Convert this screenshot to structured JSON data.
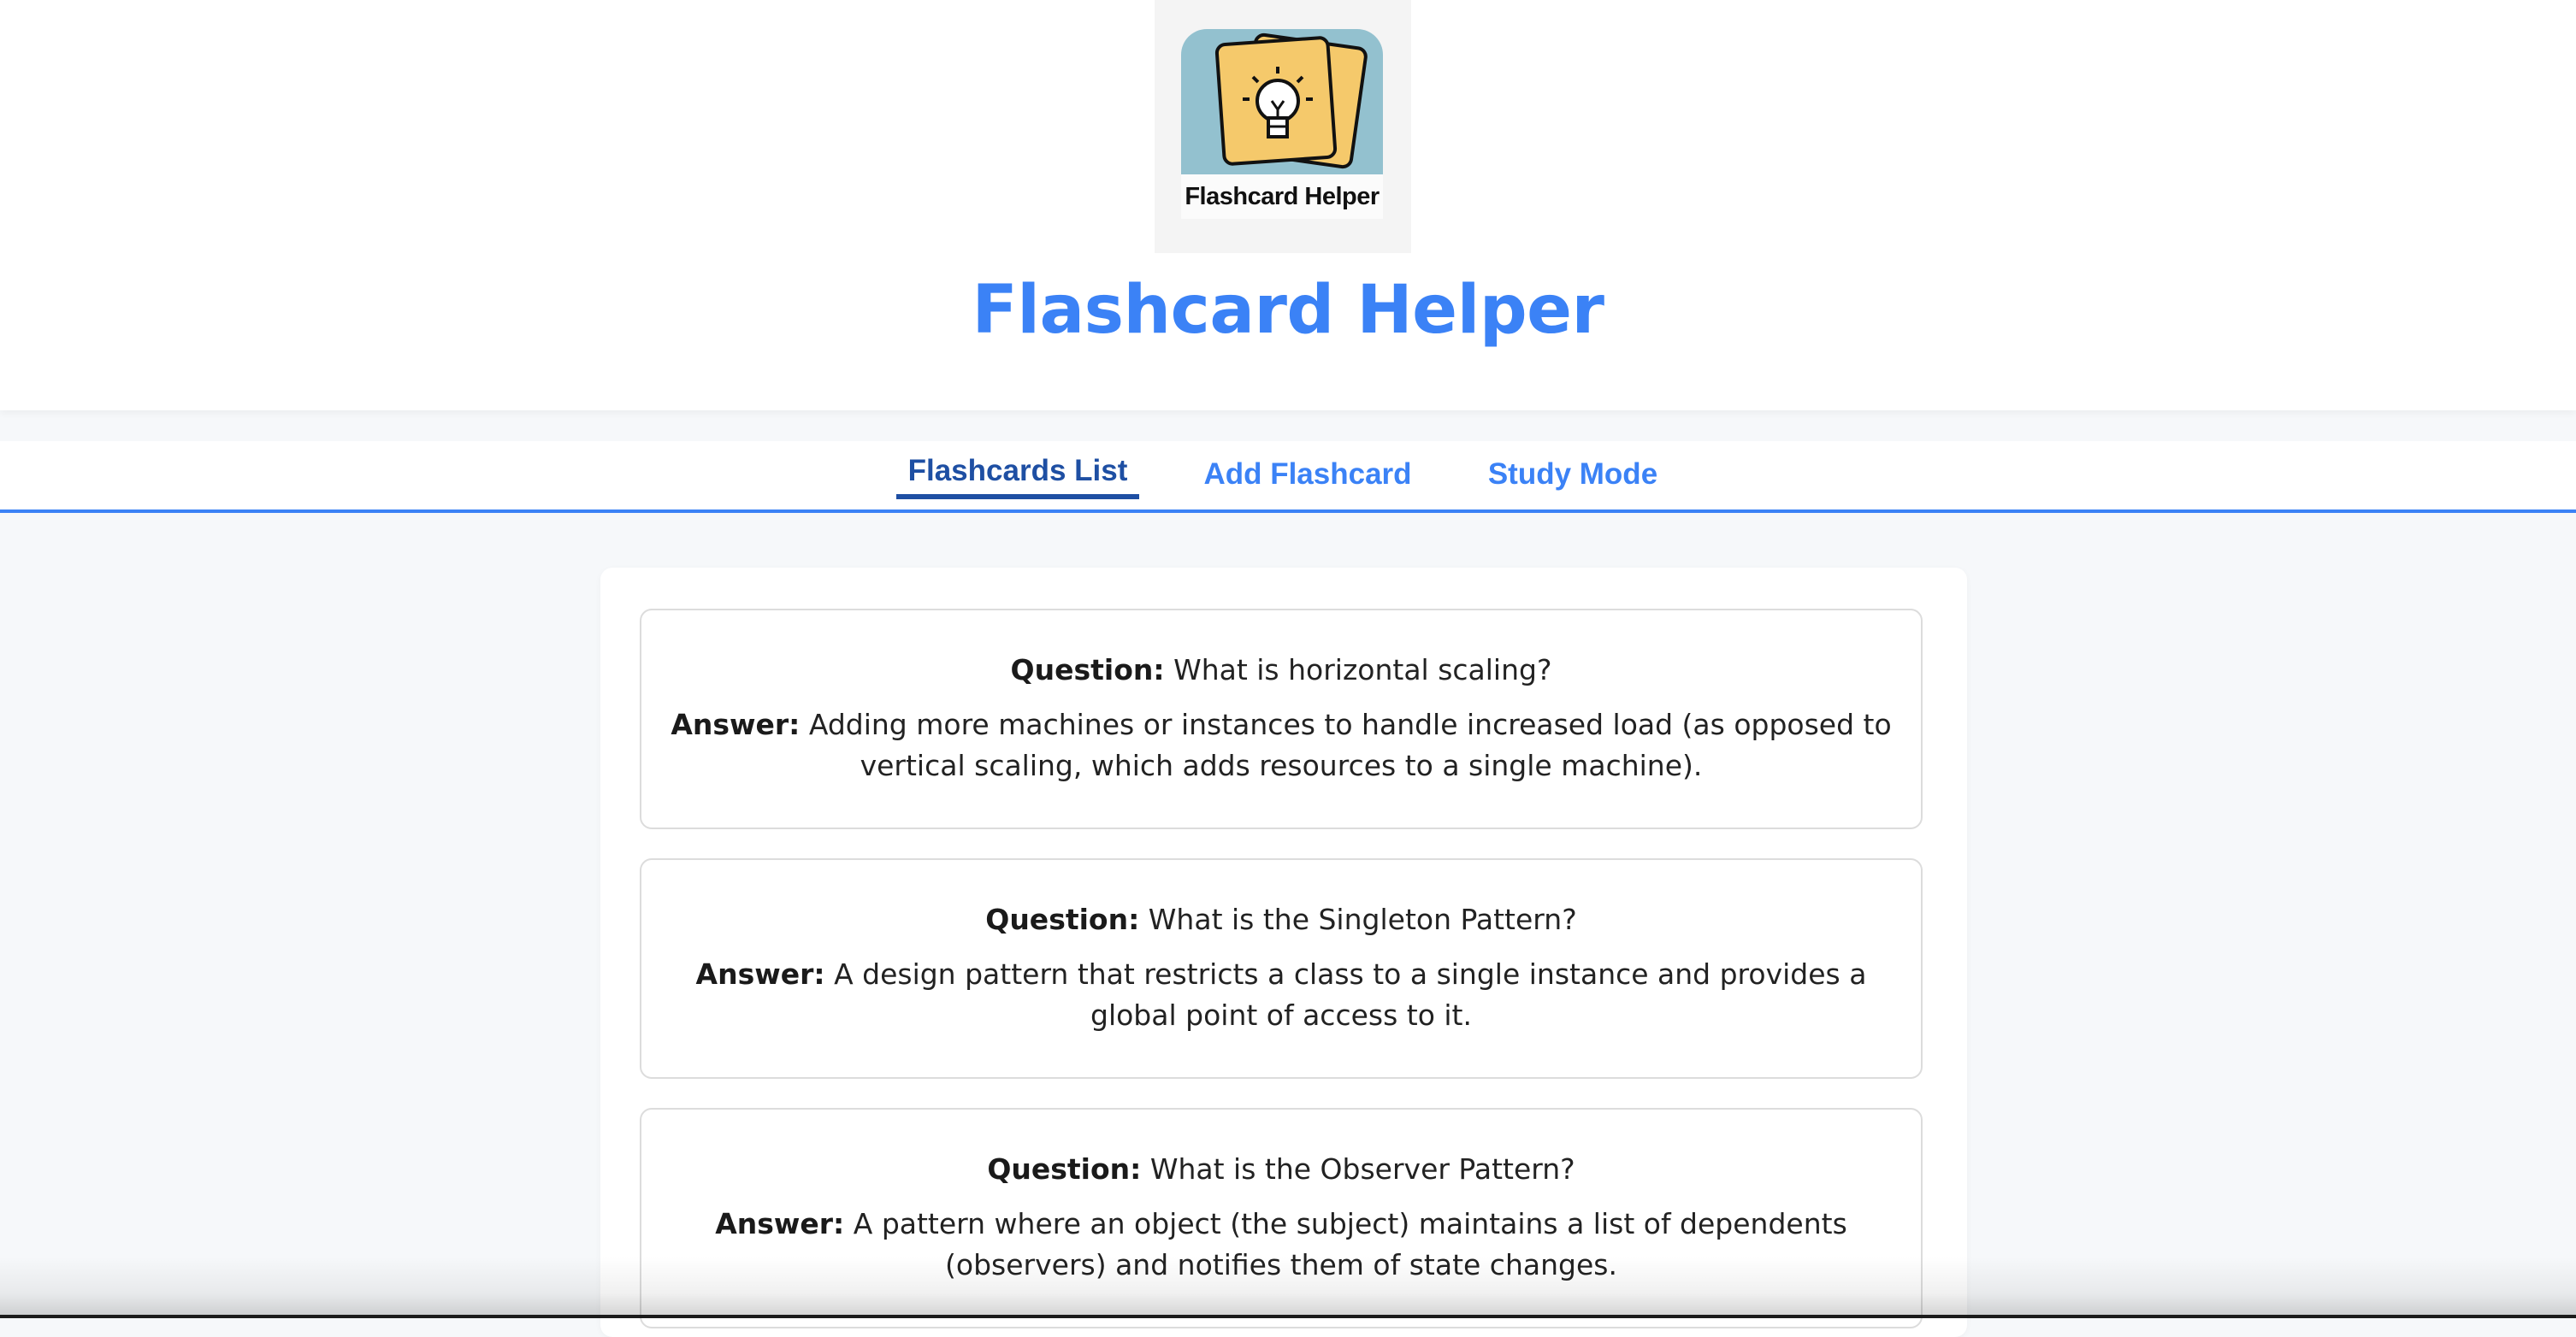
{
  "header": {
    "logo_caption": "Flashcard Helper",
    "logo_icon": "lightbulb-icon",
    "title": "Flashcard Helper"
  },
  "nav": {
    "tabs": [
      {
        "label": "Flashcards List",
        "active": true
      },
      {
        "label": "Add Flashcard",
        "active": false
      },
      {
        "label": "Study Mode",
        "active": false
      }
    ]
  },
  "flashcards": {
    "question_label": "Question:",
    "answer_label": "Answer:",
    "items": [
      {
        "question": "What is horizontal scaling?",
        "answer": "Adding more machines or instances to handle increased load (as opposed to vertical scaling, which adds resources to a single machine)."
      },
      {
        "question": "What is the Singleton Pattern?",
        "answer": "A design pattern that restricts a class to a single instance and provides a global point of access to it."
      },
      {
        "question": "What is the Observer Pattern?",
        "answer": "A pattern where an object (the subject) maintains a list of dependents (observers) and notifies them of state changes."
      }
    ]
  },
  "colors": {
    "accent": "#3b82f6",
    "active_tab": "#1e4fa3",
    "logo_bg": "#93c1cf",
    "card_yellow": "#f5c96b"
  }
}
